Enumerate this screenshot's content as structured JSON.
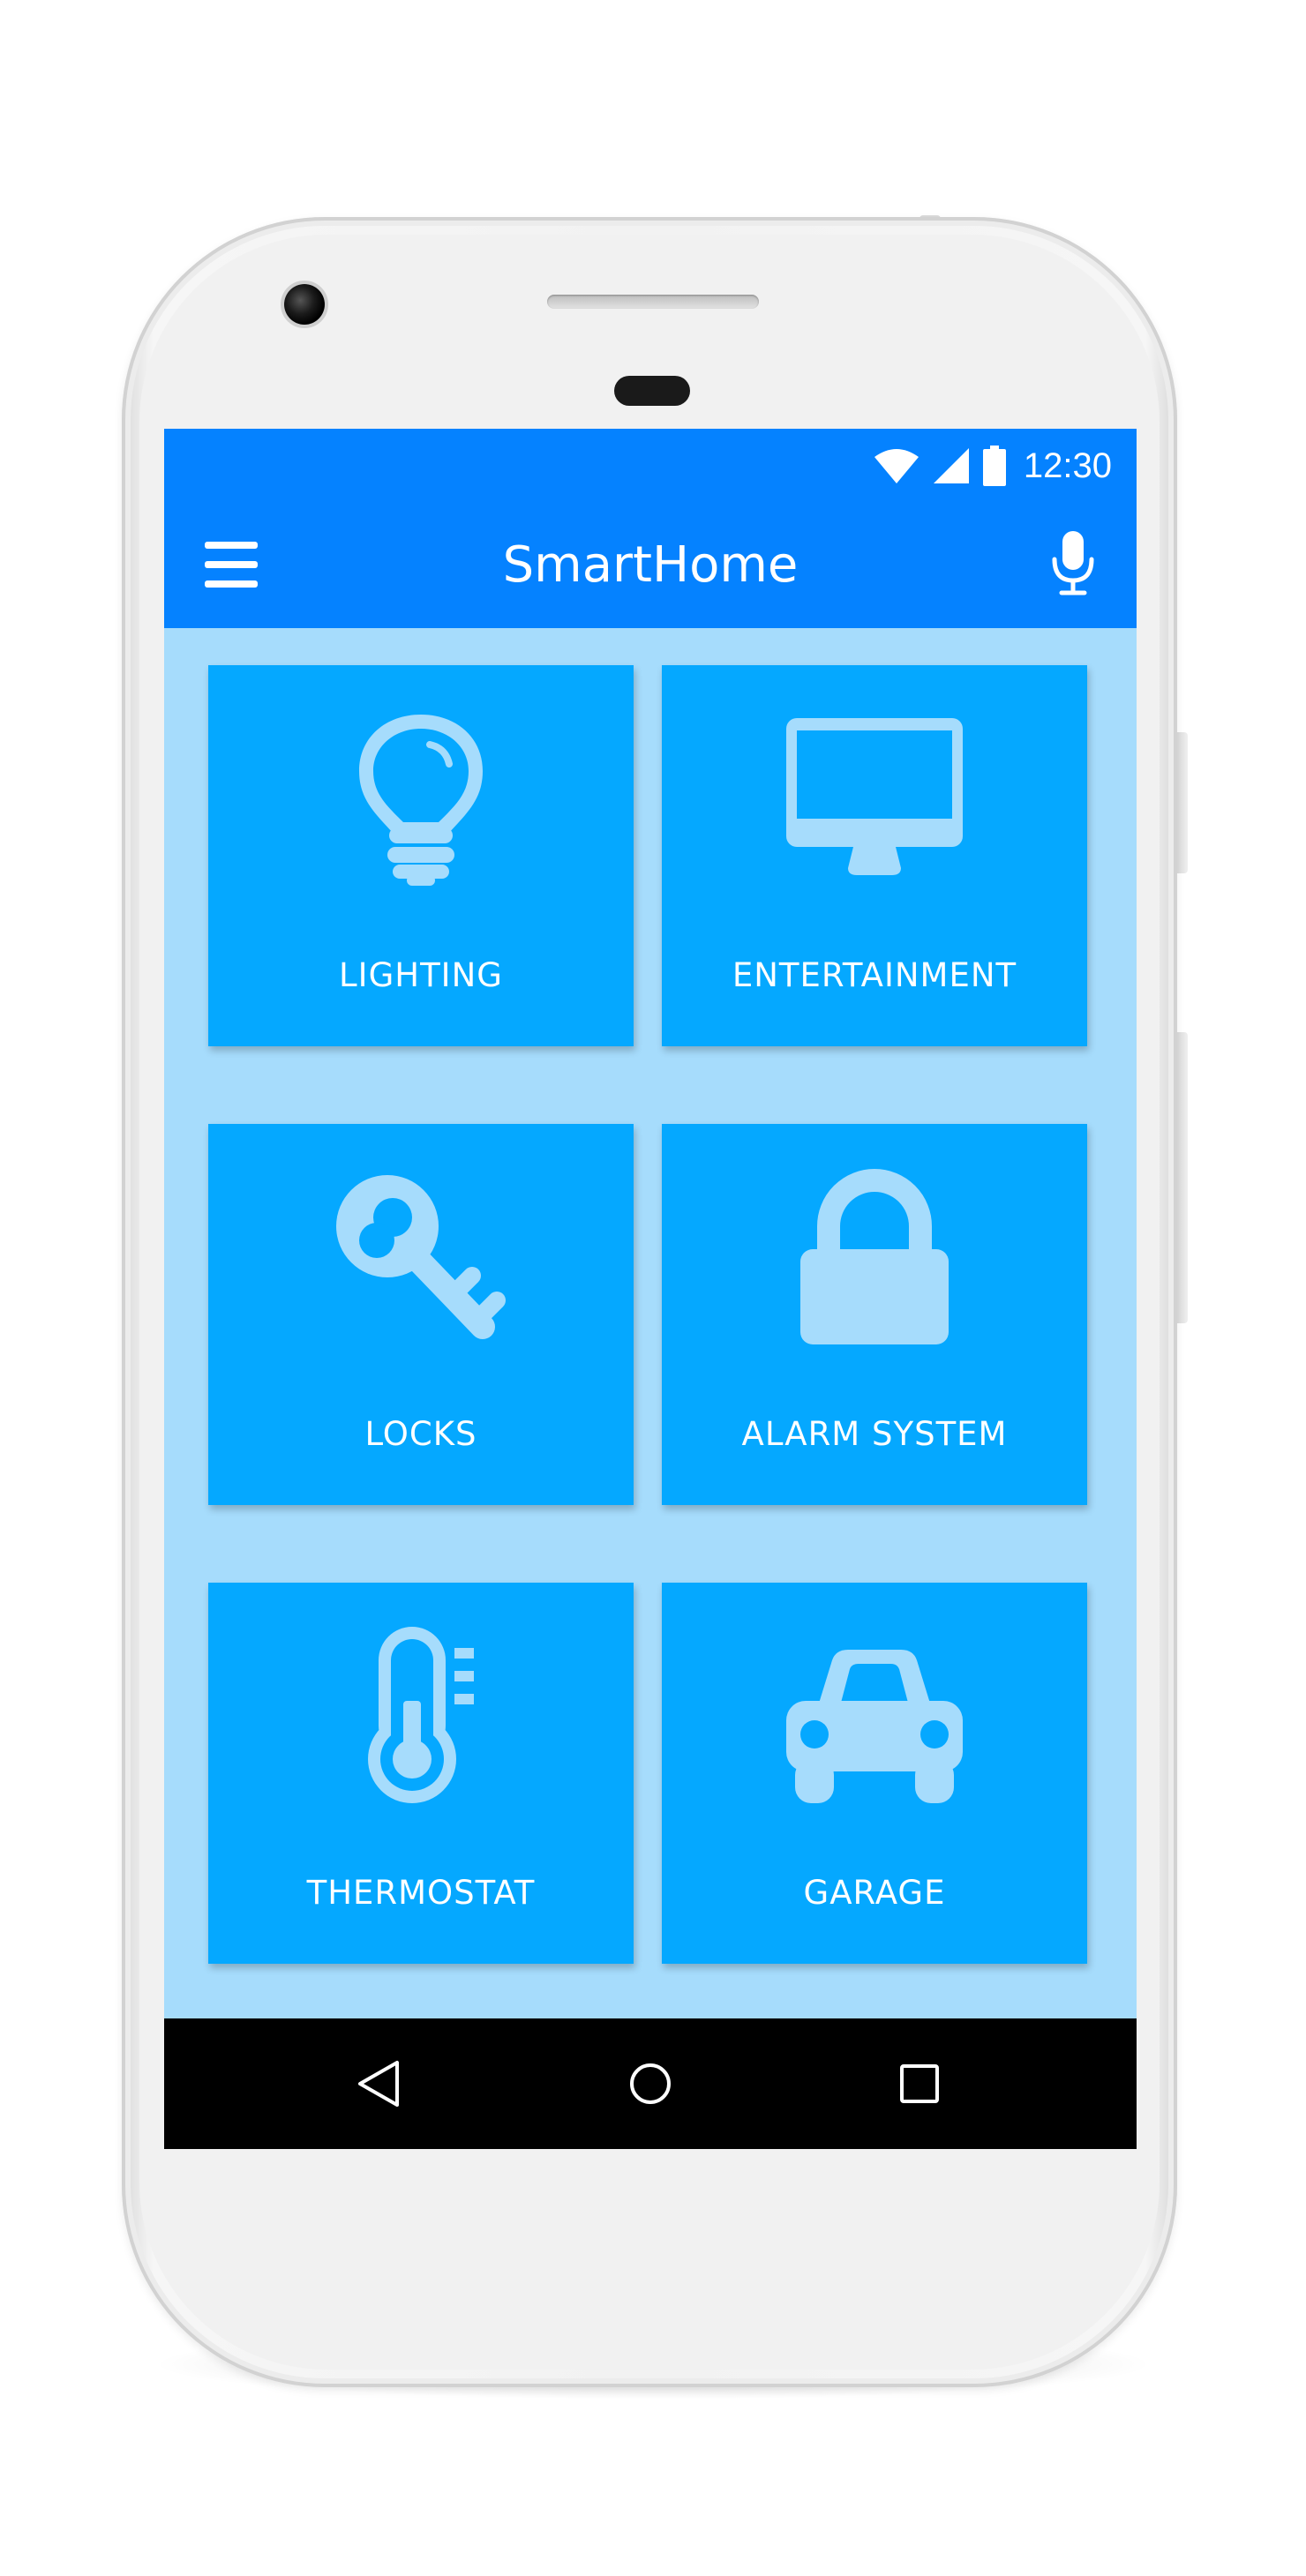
{
  "status_bar": {
    "time": "12:30",
    "icons": [
      "wifi-icon",
      "signal-icon",
      "battery-icon"
    ]
  },
  "app_bar": {
    "title": "SmartHome",
    "left_icon": "menu-icon",
    "right_icon": "microphone-icon"
  },
  "tiles": [
    {
      "label": "LIGHTING",
      "icon": "lightbulb-icon"
    },
    {
      "label": "ENTERTAINMENT",
      "icon": "monitor-icon"
    },
    {
      "label": "LOCKS",
      "icon": "key-icon"
    },
    {
      "label": "ALARM SYSTEM",
      "icon": "padlock-icon"
    },
    {
      "label": "THERMOSTAT",
      "icon": "thermometer-icon"
    },
    {
      "label": "GARAGE",
      "icon": "car-icon"
    }
  ],
  "nav_bar": {
    "icons": [
      "back-icon",
      "home-icon",
      "recent-apps-icon"
    ]
  },
  "colors": {
    "app_bar": "#0582ff",
    "background": "#a6dcfc",
    "tile": "#05a8ff",
    "icon": "#a6dcfc",
    "text": "#ffffff",
    "nav_bar": "#000000"
  }
}
